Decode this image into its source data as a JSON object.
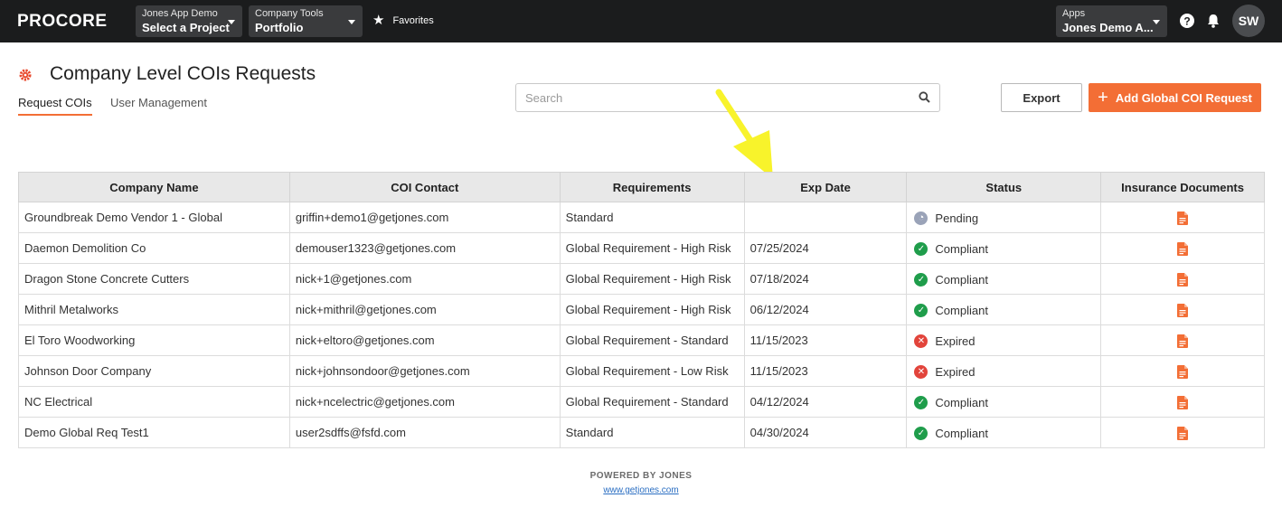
{
  "topbar": {
    "logo": "PROCORE",
    "project_selector": {
      "small": "Jones App Demo",
      "big": "Select a Project"
    },
    "tool_selector": {
      "small": "Company Tools",
      "big": "Portfolio"
    },
    "favorites_label": "Favorites",
    "apps_selector": {
      "small": "Apps",
      "big": "Jones Demo A..."
    },
    "avatar_initials": "SW"
  },
  "page": {
    "title": "Company Level COIs Requests",
    "tabs": [
      {
        "label": "Request COIs",
        "active": true
      },
      {
        "label": "User Management",
        "active": false
      }
    ],
    "search_placeholder": "Search",
    "export_label": "Export",
    "add_label": "Add Global COI Request"
  },
  "table": {
    "columns": [
      "Company Name",
      "COI Contact",
      "Requirements",
      "Exp Date",
      "Status",
      "Insurance Documents"
    ],
    "rows": [
      {
        "company": "Groundbreak Demo Vendor 1 - Global",
        "contact": "griffin+demo1@getjones.com",
        "requirements": "Standard",
        "exp_date": "",
        "status": "Pending"
      },
      {
        "company": "Daemon Demolition Co",
        "contact": "demouser1323@getjones.com",
        "requirements": "Global Requirement - High Risk",
        "exp_date": "07/25/2024",
        "status": "Compliant"
      },
      {
        "company": "Dragon Stone Concrete Cutters",
        "contact": "nick+1@getjones.com",
        "requirements": "Global Requirement - High Risk",
        "exp_date": "07/18/2024",
        "status": "Compliant"
      },
      {
        "company": "Mithril Metalworks",
        "contact": "nick+mithril@getjones.com",
        "requirements": "Global Requirement - High Risk",
        "exp_date": "06/12/2024",
        "status": "Compliant"
      },
      {
        "company": "El Toro Woodworking",
        "contact": "nick+eltoro@getjones.com",
        "requirements": "Global Requirement - Standard",
        "exp_date": "11/15/2023",
        "status": "Expired"
      },
      {
        "company": "Johnson Door Company",
        "contact": "nick+johnsondoor@getjones.com",
        "requirements": "Global Requirement - Low Risk",
        "exp_date": "11/15/2023",
        "status": "Expired"
      },
      {
        "company": "NC Electrical",
        "contact": "nick+ncelectric@getjones.com",
        "requirements": "Global Requirement - Standard",
        "exp_date": "04/12/2024",
        "status": "Compliant"
      },
      {
        "company": "Demo Global Req Test1",
        "contact": "user2sdffs@fsfd.com",
        "requirements": "Standard",
        "exp_date": "04/30/2024",
        "status": "Compliant"
      }
    ]
  },
  "footer": {
    "powered_by": "POWERED BY JONES",
    "link": "www.getjones.com"
  },
  "colors": {
    "accent": "#f36e35",
    "compliant": "#1f9d4b",
    "expired": "#e2443b",
    "pending": "#9aa3b8",
    "annotation_arrow": "#f8f32b"
  }
}
